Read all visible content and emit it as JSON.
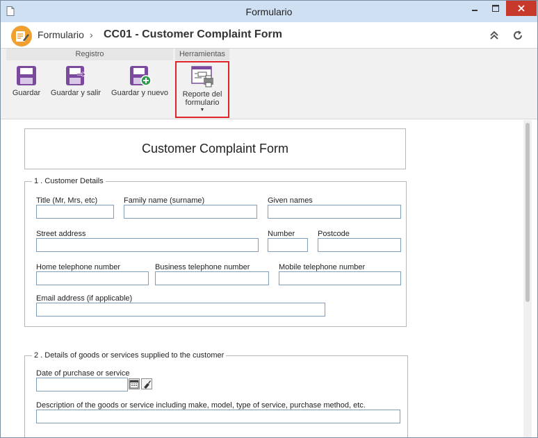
{
  "window": {
    "title": "Formulario"
  },
  "header": {
    "breadcrumb": "Formulario",
    "separator": "›",
    "page_title": "CC01 - Customer Complaint Form"
  },
  "ribbon": {
    "groups": [
      "Registro",
      "Herramientas"
    ],
    "buttons": {
      "save": "Guardar",
      "save_exit": "Guardar y salir",
      "save_new": "Guardar y nuevo",
      "report_line1": "Reporte del",
      "report_line2": "formulario",
      "report_caret": "▼"
    }
  },
  "form": {
    "title": "Customer Complaint Form",
    "section1": {
      "legend": "1 . Customer Details",
      "fields": {
        "title": {
          "label": "Title (Mr, Mrs, etc)",
          "value": ""
        },
        "family_name": {
          "label": "Family name (surname)",
          "value": ""
        },
        "given_names": {
          "label": "Given names",
          "value": ""
        },
        "street": {
          "label": "Street address",
          "value": ""
        },
        "number": {
          "label": "Number",
          "value": ""
        },
        "postcode": {
          "label": "Postcode",
          "value": ""
        },
        "home_phone": {
          "label": "Home telephone number",
          "value": ""
        },
        "business_phone": {
          "label": "Business telephone number",
          "value": ""
        },
        "mobile_phone": {
          "label": "Mobile telephone number",
          "value": ""
        },
        "email": {
          "label": "Email address (if applicable)",
          "value": ""
        }
      }
    },
    "section2": {
      "legend": "2 . Details of goods or services supplied to the customer",
      "fields": {
        "purchase_date": {
          "label": "Date of purchase or service",
          "value": ""
        },
        "description": {
          "label": "Description of the goods or service including make, model, type of service, purchase method, etc.",
          "value": ""
        }
      }
    }
  },
  "colors": {
    "highlight": "#e0222a",
    "icon_purple": "#7b4a9e",
    "logo_orange": "#f0a030",
    "titlebar": "#cfe0f3",
    "close": "#c7392b"
  }
}
